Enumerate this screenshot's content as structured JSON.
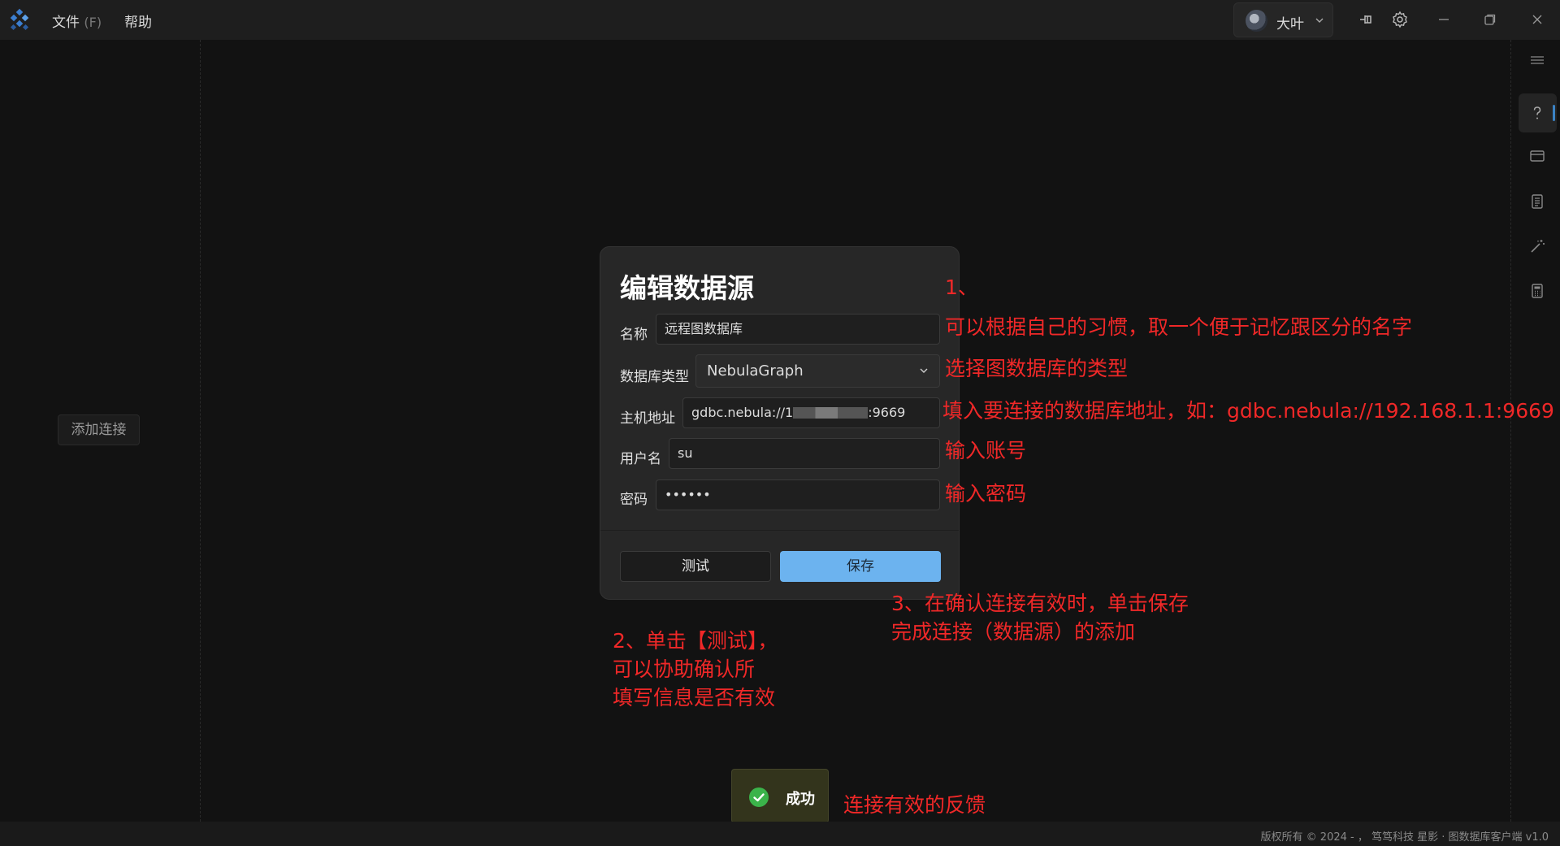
{
  "titlebar": {
    "menu": [
      {
        "label": "文件",
        "hotkey": "(F)"
      },
      {
        "label": "帮助",
        "hotkey": ""
      }
    ],
    "user": {
      "name": "大叶"
    }
  },
  "left_panel": {
    "add_connection_label": "添加连接"
  },
  "dialog": {
    "title": "编辑数据源",
    "fields": {
      "name": {
        "label": "名称",
        "value": "远程图数据库"
      },
      "db_type": {
        "label": "数据库类型",
        "value": "NebulaGraph"
      },
      "host": {
        "label": "主机地址",
        "value_prefix": "gdbc.nebula://1",
        "value_suffix": ":9669"
      },
      "username": {
        "label": "用户名",
        "value": "su"
      },
      "password": {
        "label": "密码",
        "value": "••••••"
      }
    },
    "buttons": {
      "test": "测试",
      "save": "保存"
    }
  },
  "annotations": {
    "a1_num": "1、",
    "a1_text": "可以根据自己的习惯，取一个便于记忆跟区分的名字",
    "a_type": "选择图数据库的类型",
    "a_host": "填入要连接的数据库地址，如：gdbc.nebula://192.168.1.1:9669",
    "a_user": "输入账号",
    "a_pass": "输入密码",
    "a3_line1": "3、在确认连接有效时，单击保存",
    "a3_line2": "完成连接（数据源）的添加",
    "a2_line1": "2、单击【测试】，",
    "a2_line2": "可以协助确认所",
    "a2_line3": "填写信息是否有效",
    "a_toast": "连接有效的反馈"
  },
  "toast": {
    "text": "成功"
  },
  "statusbar": {
    "text": "版权所有 © 2024 - ， 笃笃科技 星影 · 图数据库客户端 v1.0"
  },
  "colors": {
    "accent": "#6cb3ef",
    "annotation": "#f02828",
    "success": "#3bb34a"
  }
}
